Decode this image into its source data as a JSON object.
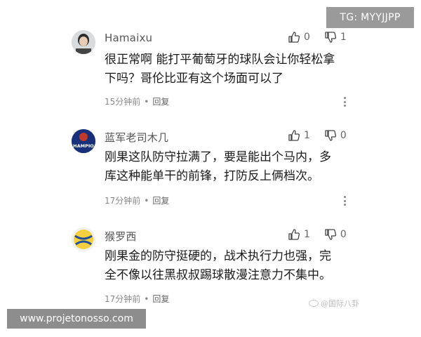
{
  "watermark_top": "TG: MYYJJPP",
  "watermark_bottom": "www.projetonosso.com",
  "watermark_weibo": "@国际八卦",
  "comments": [
    {
      "username": "Hamaixu",
      "lines": [
        "很正常啊 能打平葡萄牙的球队会让你轻松拿",
        "下吗？哥伦比亚有这个场面可以了"
      ],
      "time": "15分钟前",
      "reply": "回复",
      "likes": "0",
      "dislikes": "1",
      "avatar_color": "#c9ccd0"
    },
    {
      "username": "蓝军老司木几",
      "lines": [
        "刚果这队防守拉满了，要是能出个马内，多",
        "库这种能单干的前锋，打防反上俩档次。"
      ],
      "time": "17分钟前",
      "reply": "回复",
      "likes": "1",
      "dislikes": "0",
      "avatar_text": "HAMPIO",
      "avatar_color": "#1f3a8a"
    },
    {
      "username": "猴罗西",
      "lines": [
        "刚果金的防守挺硬的，战术执行力也强，完",
        "全不像以往黑叔叔踢球散漫注意力不集中。"
      ],
      "time": "17分钟前",
      "reply": "回复",
      "likes": "1",
      "dislikes": "0",
      "avatar_color": "#e8c24a"
    }
  ]
}
